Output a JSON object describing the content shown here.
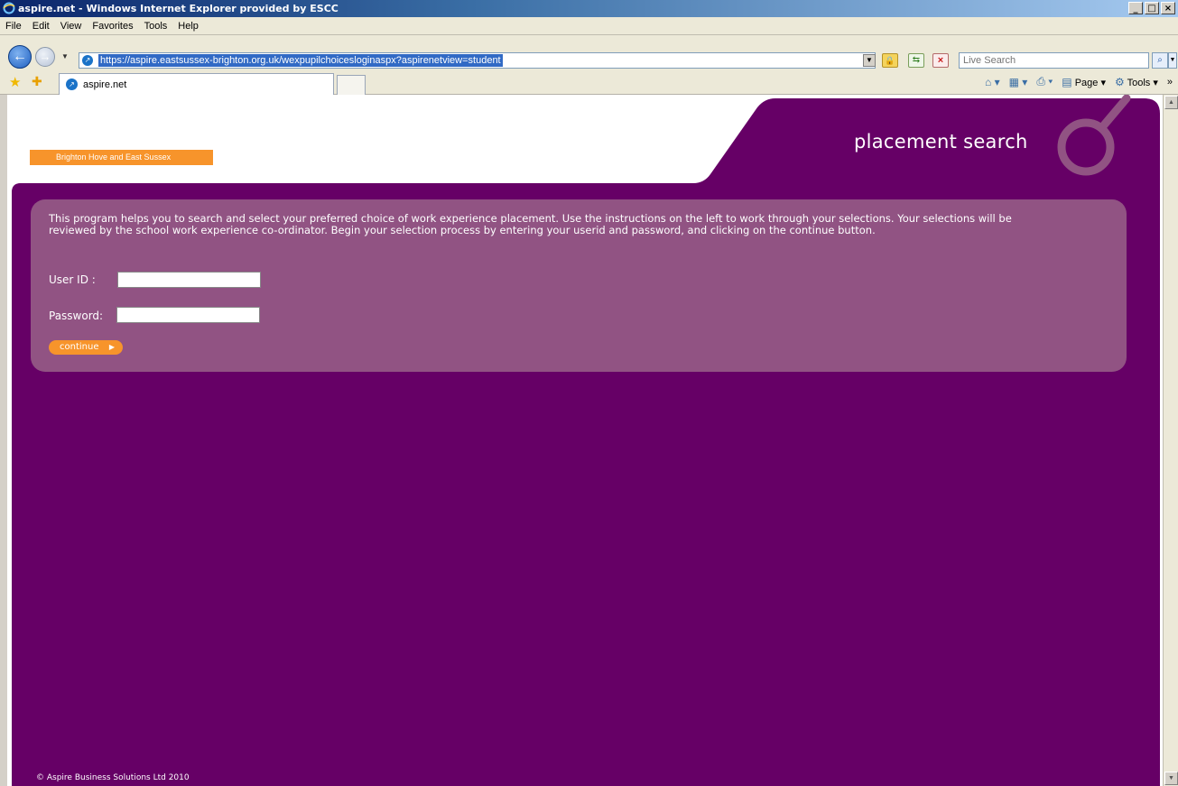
{
  "window": {
    "title": "aspire.net - Windows Internet Explorer provided by ESCC",
    "min_label": "_",
    "max_label": "□",
    "close_label": "×"
  },
  "menu": {
    "items": [
      "File",
      "Edit",
      "View",
      "Favorites",
      "Tools",
      "Help"
    ]
  },
  "navbar": {
    "url": "https://aspire.eastsussex-brighton.org.uk/wexpupilchoicesloginaspx?aspirenetview=student",
    "search_placeholder": "Live Search"
  },
  "tabs": {
    "active_label": "aspire.net",
    "page_label": "Page",
    "tools_label": "Tools"
  },
  "page": {
    "org_badge": "Brighton Hove and East Sussex",
    "title": "placement search",
    "intro": "This program helps you to search and select your preferred choice of work experience placement. Use the instructions on the left to work through your selections. Your selections will be reviewed by the school work experience co-ordinator. Begin your selection process by entering your userid and password, and clicking on the continue button.",
    "userid_label": "User ID   :",
    "password_label": "Password:",
    "userid_value": "",
    "password_value": "",
    "continue_label": "continue",
    "copyright": "© Aspire Business Solutions Ltd 2010"
  },
  "colors": {
    "brand_purple": "#660066",
    "panel_purple": "#915383",
    "accent_orange": "#f7942b"
  }
}
